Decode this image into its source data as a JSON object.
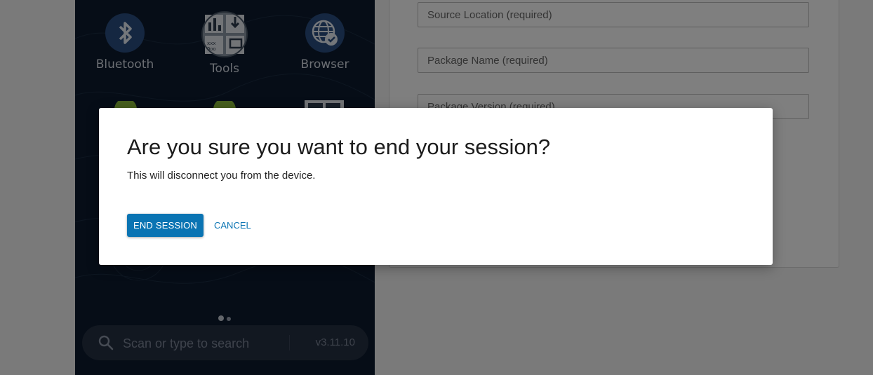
{
  "device": {
    "apps": [
      {
        "label": "Bluetooth",
        "icon": "bluetooth-icon"
      },
      {
        "label": "Tools",
        "icon": "tools-icon"
      },
      {
        "label": "Browser",
        "icon": "browser-icon"
      }
    ],
    "second_row_icons": [
      "android-icon",
      "android-icon",
      "window-grid-icon"
    ],
    "page_indicator": {
      "pages": 2,
      "current": 1
    },
    "search": {
      "placeholder": "Scan or type to search",
      "version": "v3.11.10"
    }
  },
  "form": {
    "fields": [
      {
        "placeholder": "Source Location (required)"
      },
      {
        "placeholder": "Package Name (required)"
      },
      {
        "placeholder": "Package Version (required)"
      }
    ]
  },
  "dialog": {
    "title": "Are you sure you want to end your session?",
    "message": "This will disconnect you from the device.",
    "confirm_label": "END SESSION",
    "cancel_label": "CANCEL"
  },
  "colors": {
    "primary": "#0a74b3",
    "device_bg": "#0d1b2e",
    "overlay": "rgba(0,0,0,0.5)"
  }
}
